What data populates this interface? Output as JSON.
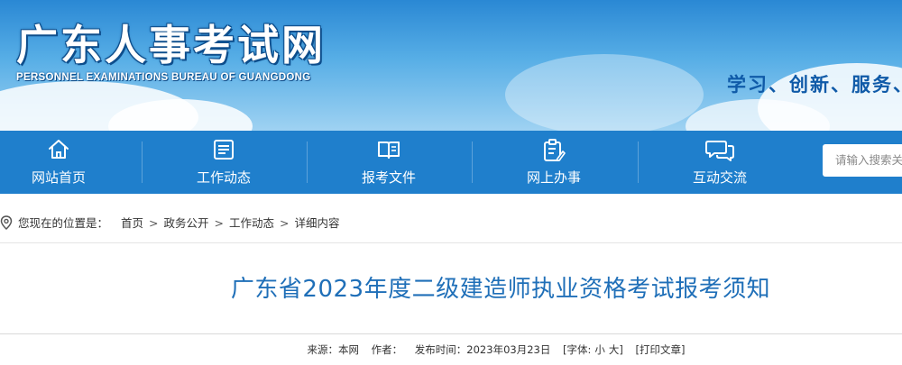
{
  "header": {
    "site_title": "广东人事考试网",
    "site_subtitle": "PERSONNEL EXAMINATIONS BUREAU OF GUANGDONG",
    "slogan": "学习、创新、服务、"
  },
  "nav": {
    "items": [
      {
        "label": "网站首页",
        "icon": "home-icon"
      },
      {
        "label": "工作动态",
        "icon": "news-list-icon"
      },
      {
        "label": "报考文件",
        "icon": "open-book-icon"
      },
      {
        "label": "网上办事",
        "icon": "clipboard-edit-icon"
      },
      {
        "label": "互动交流",
        "icon": "chat-bubble-icon"
      }
    ],
    "search_placeholder": "请输入搜索关"
  },
  "breadcrumb": {
    "prefix": "您现在的位置是：",
    "items": [
      "首页",
      "政务公开",
      "工作动态",
      "详细内容"
    ],
    "separator": ">"
  },
  "article": {
    "title": "广东省2023年度二级建造师执业资格考试报考须知",
    "meta": {
      "source_label": "来源：本网",
      "author_label": "作者：",
      "date_label": "发布时间：2023年03月23日",
      "font_label_open": "[字体:",
      "font_small": "小",
      "font_large": "大",
      "font_label_close": "]",
      "print_label": "[打印文章]"
    }
  },
  "colors": {
    "nav_bg": "#1f7fcc",
    "title_blue": "#1f6fb8",
    "slogan_blue": "#0f5aa8"
  }
}
